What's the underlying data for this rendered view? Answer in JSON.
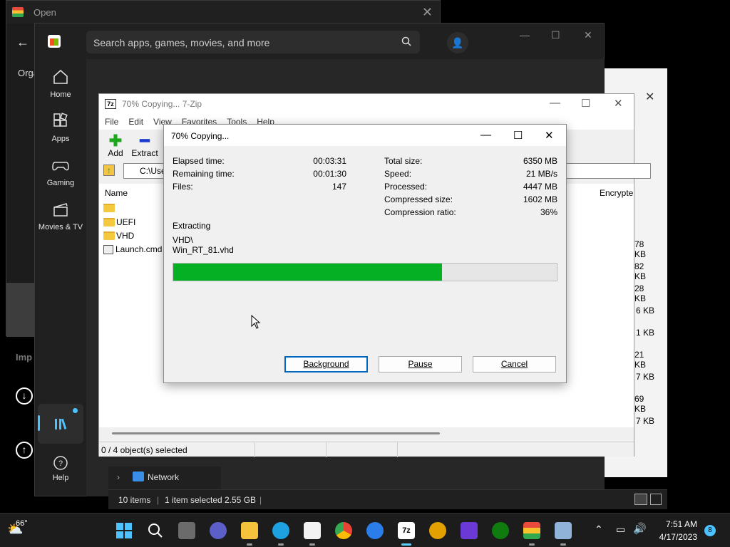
{
  "open_dialog": {
    "title": "Open",
    "org_label": "Orga"
  },
  "store": {
    "search_placeholder": "Search apps, games, movies, and more",
    "nav": [
      {
        "label": "Home"
      },
      {
        "label": "Apps"
      },
      {
        "label": "Gaming"
      },
      {
        "label": "Movies & TV"
      },
      {
        "label": "Help"
      }
    ],
    "library_heading": "Library",
    "imp_label": "Imp"
  },
  "zip": {
    "title": "70% Copying... 7-Zip",
    "menu": [
      "File",
      "Edit",
      "View",
      "Favorites",
      "Tools",
      "Help"
    ],
    "toolbar": {
      "add": "Add",
      "extract": "Extract"
    },
    "address": "C:\\Use",
    "columns": {
      "name": "Name",
      "encrypted": "Encrypte"
    },
    "files": [
      {
        "name": "",
        "type": "folder"
      },
      {
        "name": "UEFI",
        "type": "folder"
      },
      {
        "name": "VHD",
        "type": "folder"
      },
      {
        "name": "Launch.cmd",
        "type": "cmd"
      }
    ],
    "sizes": [
      "78 KB",
      "82 KB",
      "28 KB",
      "6 KB",
      "1 KB",
      "21 KB",
      "7 KB",
      "69 KB",
      "7 KB"
    ],
    "status": "0 / 4 object(s) selected"
  },
  "progress": {
    "title": "70% Copying...",
    "left_labels": [
      {
        "label": "Elapsed time:",
        "value": "00:03:31"
      },
      {
        "label": "Remaining time:",
        "value": "00:01:30"
      },
      {
        "label": "Files:",
        "value": "147"
      }
    ],
    "right_labels": [
      {
        "label": "Total size:",
        "value": "6350 MB"
      },
      {
        "label": "Speed:",
        "value": "21 MB/s"
      },
      {
        "label": "Processed:",
        "value": "4447 MB"
      },
      {
        "label": "Compressed size:",
        "value": "1602 MB"
      },
      {
        "label": "Compression ratio:",
        "value": "36%"
      }
    ],
    "action": "Extracting",
    "path_line1": "VHD\\",
    "path_line2": "Win_RT_81.vhd",
    "percent": 70,
    "buttons": {
      "background": "Background",
      "pause": "Pause",
      "cancel": "Cancel"
    }
  },
  "explorer": {
    "nav_network": "Network",
    "items_count": "10 items",
    "selected": "1 item selected",
    "selected_size": "2.55 GB"
  },
  "taskbar": {
    "weather": "66°",
    "time": "7:51 AM",
    "date": "4/17/2023",
    "notifications": "8"
  },
  "colors": {
    "progress_fill": "#06b025",
    "accent": "#4cc2ff"
  }
}
